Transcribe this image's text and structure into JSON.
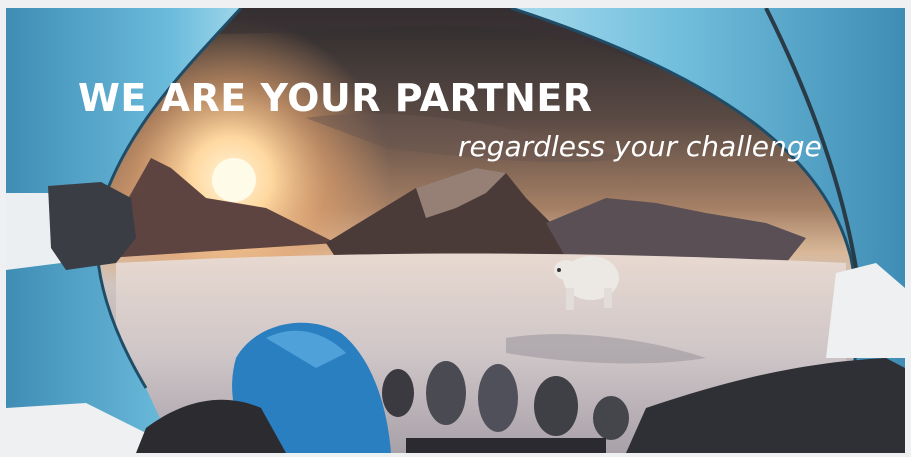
{
  "banner": {
    "headline": "WE ARE YOUR PARTNER",
    "subline": "regardless your challenge"
  },
  "colors": {
    "tent": "#5eb0d3",
    "tent_dark": "#2e6f93",
    "sun": "#ffd8a0",
    "snow": "#d8d0d2",
    "mountain": "#4a3a38"
  }
}
